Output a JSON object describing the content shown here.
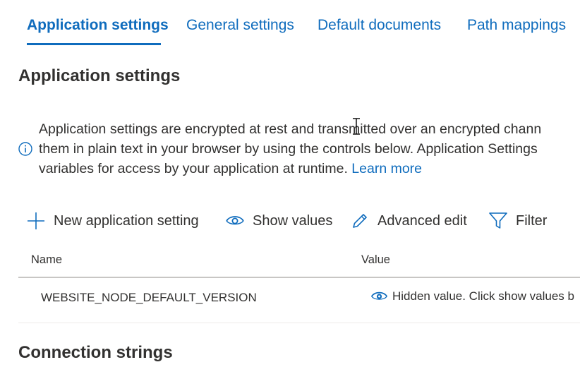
{
  "tabs": [
    {
      "label": "Application settings"
    },
    {
      "label": "General settings"
    },
    {
      "label": "Default documents"
    },
    {
      "label": "Path mappings"
    }
  ],
  "headings": {
    "app_settings": "Application settings",
    "connection_strings": "Connection strings"
  },
  "info": {
    "line1": "Application settings are encrypted at rest and transmitted over an encrypted chann",
    "line2": "them in plain text in your browser by using the controls below. Application Settings",
    "line3": "variables for access by your application at runtime.",
    "link": "Learn more"
  },
  "toolbar": {
    "new_setting": "New application setting",
    "show_values": "Show values",
    "advanced_edit": "Advanced edit",
    "filter": "Filter"
  },
  "table": {
    "columns": [
      "Name",
      "Value"
    ],
    "rows": [
      {
        "name": "WEBSITE_NODE_DEFAULT_VERSION",
        "value": "Hidden value. Click show values b"
      }
    ]
  },
  "colors": {
    "accent": "#0f6cbd",
    "text": "#323130",
    "divider": "#c8c6c4"
  }
}
